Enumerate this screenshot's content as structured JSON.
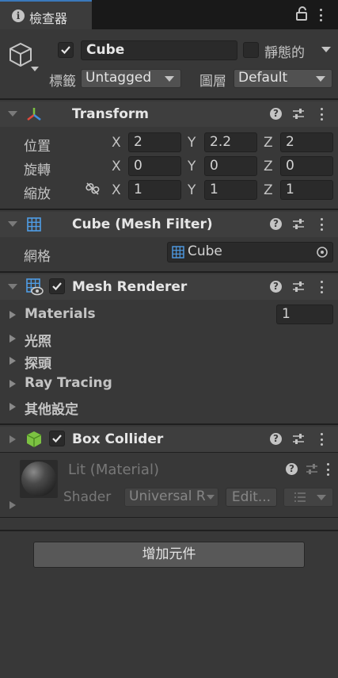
{
  "tab": {
    "label": "檢查器"
  },
  "object": {
    "name": "Cube",
    "static_label": "靜態的",
    "tag_label": "標籤",
    "tag_value": "Untagged",
    "layer_label": "圖層",
    "layer_value": "Default"
  },
  "transform": {
    "title": "Transform",
    "position_label": "位置",
    "rotation_label": "旋轉",
    "scale_label": "縮放",
    "axis_x": "X",
    "axis_y": "Y",
    "axis_z": "Z",
    "position": {
      "x": "2",
      "y": "2.2",
      "z": "2"
    },
    "rotation": {
      "x": "0",
      "y": "0",
      "z": "0"
    },
    "scale": {
      "x": "1",
      "y": "1",
      "z": "1"
    }
  },
  "mesh_filter": {
    "title": "Cube (Mesh Filter)",
    "mesh_label": "網格",
    "mesh_value": "Cube"
  },
  "mesh_renderer": {
    "title": "Mesh Renderer",
    "materials_label": "Materials",
    "materials_count": "1",
    "lighting_label": "光照",
    "probes_label": "探頭",
    "ray_tracing_label": "Ray Tracing",
    "other_settings_label": "其他設定"
  },
  "box_collider": {
    "title": "Box Collider"
  },
  "material": {
    "title": "Lit (Material)",
    "shader_label": "Shader",
    "shader_value": "Universal R",
    "edit_label": "Edit..."
  },
  "add_component_label": "增加元件",
  "colors": {
    "accent": "#3a79bb",
    "background": "#383838",
    "header": "#3e3e3e",
    "field": "#2a2a2a"
  },
  "icons": [
    "info-icon",
    "lock-icon",
    "kebab-menu-icon",
    "cube-icon",
    "transform-gizmo-icon",
    "help-icon",
    "preset-sliders-icon",
    "mesh-grid-icon",
    "target-picker-icon",
    "renderer-icon",
    "collider-cube-icon",
    "constrain-proportions-icon"
  ]
}
